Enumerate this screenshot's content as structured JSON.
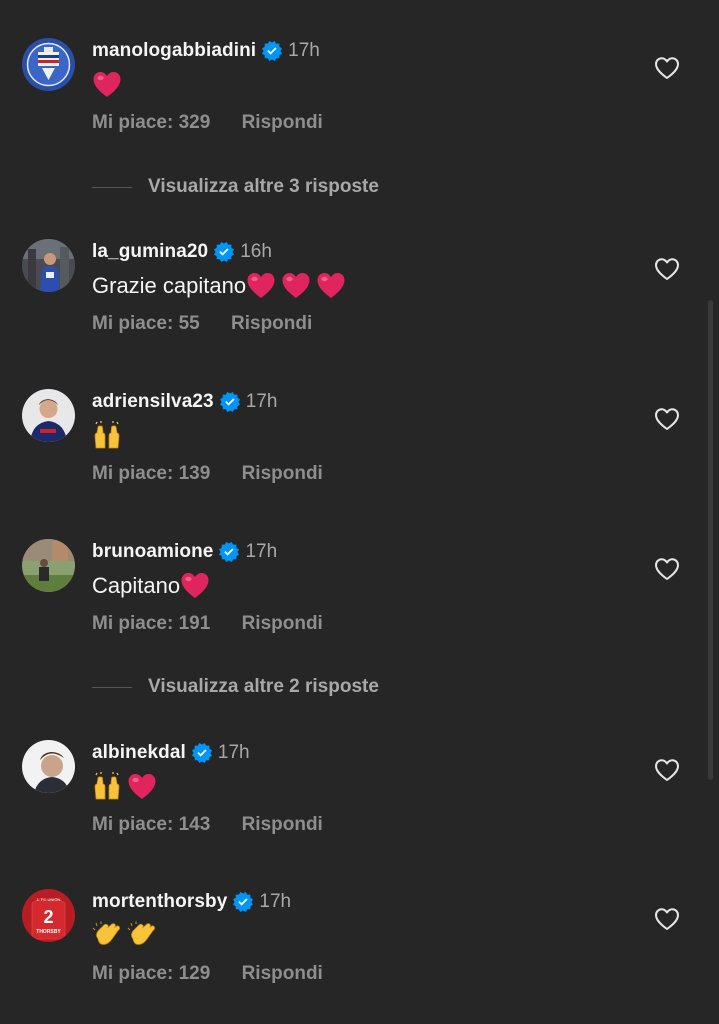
{
  "comments": [
    {
      "username": "manologabbiadini",
      "time": "17h",
      "text": "",
      "emojis": [
        "red-heart"
      ],
      "likes": "Mi piace: 329",
      "reply": "Rispondi"
    },
    {
      "username": "la_gumina20",
      "time": "16h",
      "text": "Grazie capitano",
      "emojis": [
        "red-heart",
        "red-heart",
        "red-heart"
      ],
      "likes": "Mi piace: 55",
      "reply": "Rispondi"
    },
    {
      "username": "adriensilva23",
      "time": "17h",
      "text": "",
      "emojis": [
        "raising-hands"
      ],
      "likes": "Mi piace: 139",
      "reply": "Rispondi"
    },
    {
      "username": "brunoamione",
      "time": "17h",
      "text": "Capitano",
      "emojis": [
        "red-heart"
      ],
      "likes": "Mi piace: 191",
      "reply": "Rispondi"
    },
    {
      "username": "albinekdal",
      "time": "17h",
      "text": "",
      "emojis": [
        "raising-hands",
        "red-heart"
      ],
      "likes": "Mi piace: 143",
      "reply": "Rispondi"
    },
    {
      "username": "mortenthorsby",
      "time": "17h",
      "text": "",
      "emojis": [
        "clapping-hands",
        "clapping-hands"
      ],
      "likes": "Mi piace: 129",
      "reply": "Rispondi"
    }
  ],
  "more_replies": [
    {
      "label": "Visualizza altre 3 risposte"
    },
    {
      "label": "Visualizza altre 2 risposte"
    }
  ],
  "avatar_jersey": {
    "number": "2",
    "name": "THORSBY",
    "club": "1. FC UNION"
  },
  "colors": {
    "background": "#262626",
    "text_primary": "#f5f5f5",
    "text_secondary": "#8e8e8e",
    "verified": "#0095f6",
    "heart_emoji": "#e0245e"
  }
}
